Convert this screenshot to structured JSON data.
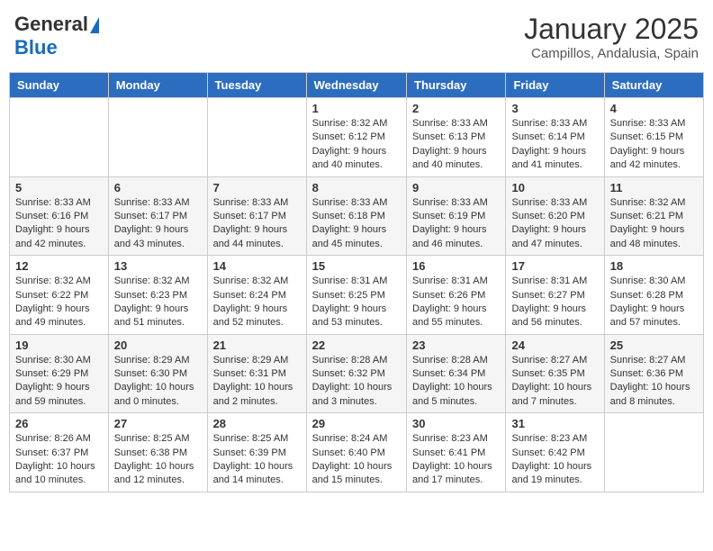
{
  "logo": {
    "general": "General",
    "blue": "Blue"
  },
  "header": {
    "month": "January 2025",
    "location": "Campillos, Andalusia, Spain"
  },
  "weekdays": [
    "Sunday",
    "Monday",
    "Tuesday",
    "Wednesday",
    "Thursday",
    "Friday",
    "Saturday"
  ],
  "weeks": [
    [
      {
        "day": "",
        "info": ""
      },
      {
        "day": "",
        "info": ""
      },
      {
        "day": "",
        "info": ""
      },
      {
        "day": "1",
        "info": "Sunrise: 8:32 AM\nSunset: 6:12 PM\nDaylight: 9 hours and 40 minutes."
      },
      {
        "day": "2",
        "info": "Sunrise: 8:33 AM\nSunset: 6:13 PM\nDaylight: 9 hours and 40 minutes."
      },
      {
        "day": "3",
        "info": "Sunrise: 8:33 AM\nSunset: 6:14 PM\nDaylight: 9 hours and 41 minutes."
      },
      {
        "day": "4",
        "info": "Sunrise: 8:33 AM\nSunset: 6:15 PM\nDaylight: 9 hours and 42 minutes."
      }
    ],
    [
      {
        "day": "5",
        "info": "Sunrise: 8:33 AM\nSunset: 6:16 PM\nDaylight: 9 hours and 42 minutes."
      },
      {
        "day": "6",
        "info": "Sunrise: 8:33 AM\nSunset: 6:17 PM\nDaylight: 9 hours and 43 minutes."
      },
      {
        "day": "7",
        "info": "Sunrise: 8:33 AM\nSunset: 6:17 PM\nDaylight: 9 hours and 44 minutes."
      },
      {
        "day": "8",
        "info": "Sunrise: 8:33 AM\nSunset: 6:18 PM\nDaylight: 9 hours and 45 minutes."
      },
      {
        "day": "9",
        "info": "Sunrise: 8:33 AM\nSunset: 6:19 PM\nDaylight: 9 hours and 46 minutes."
      },
      {
        "day": "10",
        "info": "Sunrise: 8:33 AM\nSunset: 6:20 PM\nDaylight: 9 hours and 47 minutes."
      },
      {
        "day": "11",
        "info": "Sunrise: 8:32 AM\nSunset: 6:21 PM\nDaylight: 9 hours and 48 minutes."
      }
    ],
    [
      {
        "day": "12",
        "info": "Sunrise: 8:32 AM\nSunset: 6:22 PM\nDaylight: 9 hours and 49 minutes."
      },
      {
        "day": "13",
        "info": "Sunrise: 8:32 AM\nSunset: 6:23 PM\nDaylight: 9 hours and 51 minutes."
      },
      {
        "day": "14",
        "info": "Sunrise: 8:32 AM\nSunset: 6:24 PM\nDaylight: 9 hours and 52 minutes."
      },
      {
        "day": "15",
        "info": "Sunrise: 8:31 AM\nSunset: 6:25 PM\nDaylight: 9 hours and 53 minutes."
      },
      {
        "day": "16",
        "info": "Sunrise: 8:31 AM\nSunset: 6:26 PM\nDaylight: 9 hours and 55 minutes."
      },
      {
        "day": "17",
        "info": "Sunrise: 8:31 AM\nSunset: 6:27 PM\nDaylight: 9 hours and 56 minutes."
      },
      {
        "day": "18",
        "info": "Sunrise: 8:30 AM\nSunset: 6:28 PM\nDaylight: 9 hours and 57 minutes."
      }
    ],
    [
      {
        "day": "19",
        "info": "Sunrise: 8:30 AM\nSunset: 6:29 PM\nDaylight: 9 hours and 59 minutes."
      },
      {
        "day": "20",
        "info": "Sunrise: 8:29 AM\nSunset: 6:30 PM\nDaylight: 10 hours and 0 minutes."
      },
      {
        "day": "21",
        "info": "Sunrise: 8:29 AM\nSunset: 6:31 PM\nDaylight: 10 hours and 2 minutes."
      },
      {
        "day": "22",
        "info": "Sunrise: 8:28 AM\nSunset: 6:32 PM\nDaylight: 10 hours and 3 minutes."
      },
      {
        "day": "23",
        "info": "Sunrise: 8:28 AM\nSunset: 6:34 PM\nDaylight: 10 hours and 5 minutes."
      },
      {
        "day": "24",
        "info": "Sunrise: 8:27 AM\nSunset: 6:35 PM\nDaylight: 10 hours and 7 minutes."
      },
      {
        "day": "25",
        "info": "Sunrise: 8:27 AM\nSunset: 6:36 PM\nDaylight: 10 hours and 8 minutes."
      }
    ],
    [
      {
        "day": "26",
        "info": "Sunrise: 8:26 AM\nSunset: 6:37 PM\nDaylight: 10 hours and 10 minutes."
      },
      {
        "day": "27",
        "info": "Sunrise: 8:25 AM\nSunset: 6:38 PM\nDaylight: 10 hours and 12 minutes."
      },
      {
        "day": "28",
        "info": "Sunrise: 8:25 AM\nSunset: 6:39 PM\nDaylight: 10 hours and 14 minutes."
      },
      {
        "day": "29",
        "info": "Sunrise: 8:24 AM\nSunset: 6:40 PM\nDaylight: 10 hours and 15 minutes."
      },
      {
        "day": "30",
        "info": "Sunrise: 8:23 AM\nSunset: 6:41 PM\nDaylight: 10 hours and 17 minutes."
      },
      {
        "day": "31",
        "info": "Sunrise: 8:23 AM\nSunset: 6:42 PM\nDaylight: 10 hours and 19 minutes."
      },
      {
        "day": "",
        "info": ""
      }
    ]
  ]
}
